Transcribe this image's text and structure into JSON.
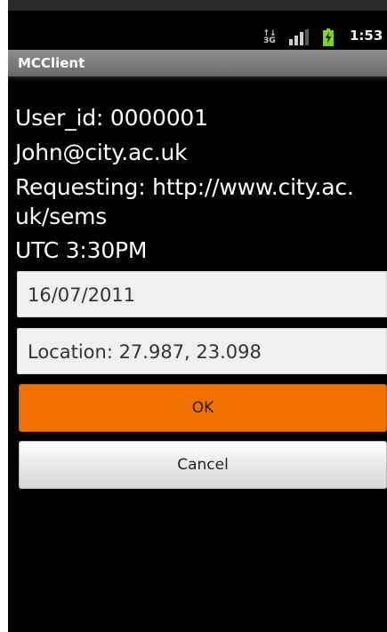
{
  "status_bar": {
    "network_icon": "3g-data-icon",
    "network_label_top": "↑↓",
    "network_label_bottom": "3G",
    "signal_icon": "signal-strength-icon",
    "battery_icon": "battery-charging-icon",
    "time": "1:53"
  },
  "app": {
    "title": "MCClient"
  },
  "info": {
    "user_id": "User_id: 0000001",
    "email": "John@city.ac.uk",
    "request_line1": "Requesting: http://www.city.ac.",
    "request_line2": "uk/sems",
    "time": "UTC 3:30PM"
  },
  "fields": {
    "date_value": "16/07/2011",
    "location_value": "Location: 27.987, 23.098"
  },
  "buttons": {
    "ok_label": "OK",
    "cancel_label": "Cancel"
  },
  "colors": {
    "accent": "#f07100",
    "background": "#000000",
    "title_bar": "#7d7d7d",
    "battery": "#7ed321"
  }
}
